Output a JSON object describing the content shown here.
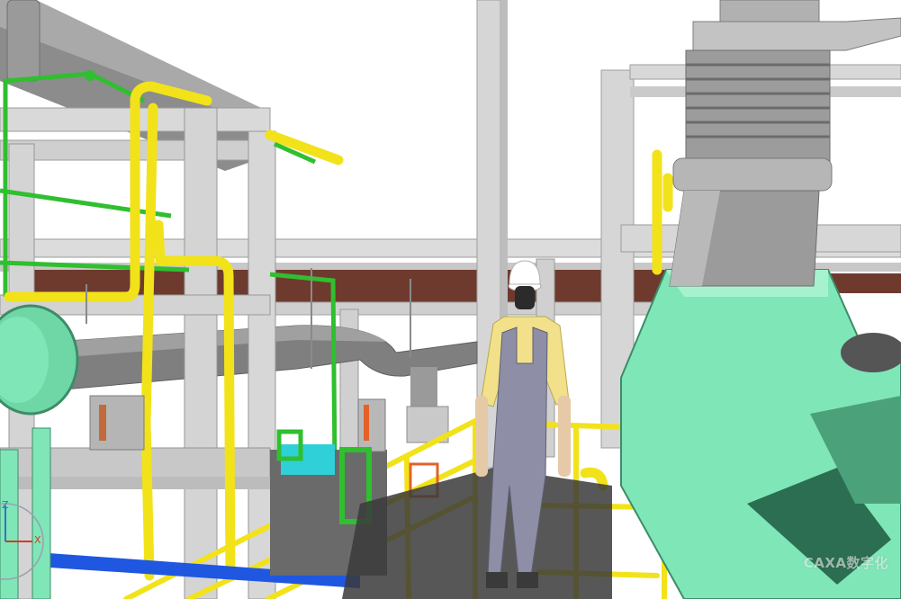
{
  "viewport": {
    "scene": "plant-3d-model",
    "axis_indicator": {
      "z_label": "Z",
      "x_label": "X"
    },
    "watermark": {
      "text": "CAXA数字化"
    }
  },
  "colors": {
    "steel": "#d6d6d6",
    "pipe_yellow": "#f2e21a",
    "pipe_green": "#2fbf2f",
    "pipe_grey": "#8a8a8a",
    "equipment_mint": "#7fe6b8",
    "pipe_blue": "#1f57e0",
    "pipe_orange": "#e2622a",
    "brick_beam": "#6e3a2e",
    "worker_shirt": "#f2e08a",
    "worker_overalls": "#8e8fa6",
    "hardhat": "#ffffff"
  }
}
